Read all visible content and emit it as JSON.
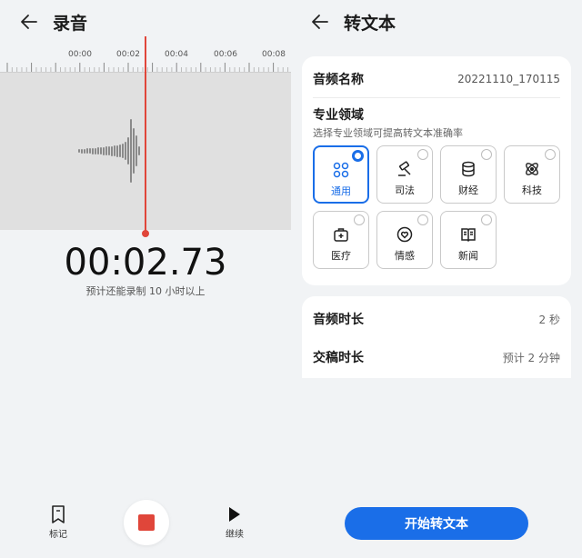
{
  "recorder": {
    "title": "录音",
    "ruler_labels": [
      "00:00",
      "00:02",
      "00:04",
      "00:06",
      "00:08"
    ],
    "timer": "00:02.73",
    "remaining": "预计还能录制 10 小时以上",
    "mark_label": "标记",
    "continue_label": "继续"
  },
  "transcribe": {
    "title": "转文本",
    "audio_name_label": "音频名称",
    "audio_name_value": "20221110_170115",
    "domain_title": "专业领域",
    "domain_subtitle": "选择专业领域可提高转文本准确率",
    "domains": [
      {
        "label": "通用",
        "icon": "grid-icon",
        "selected": true
      },
      {
        "label": "司法",
        "icon": "gavel-icon",
        "selected": false
      },
      {
        "label": "财经",
        "icon": "coins-icon",
        "selected": false
      },
      {
        "label": "科技",
        "icon": "atom-icon",
        "selected": false
      },
      {
        "label": "医疗",
        "icon": "medical-kit-icon",
        "selected": false
      },
      {
        "label": "情感",
        "icon": "heart-icon",
        "selected": false
      },
      {
        "label": "新闻",
        "icon": "newspaper-icon",
        "selected": false
      }
    ],
    "duration_label": "音频时长",
    "duration_value": "2 秒",
    "delivery_label": "交稿时长",
    "delivery_value": "预计 2 分钟",
    "start_button": "开始转文本"
  },
  "colors": {
    "accent": "#1a6ee8",
    "record_red": "#e0463a"
  }
}
